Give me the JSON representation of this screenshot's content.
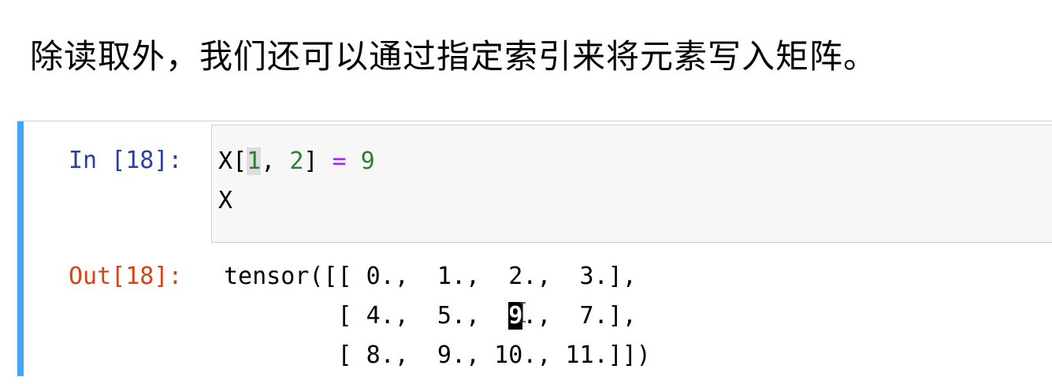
{
  "markdown": {
    "text": "除读取外，我们还可以通过指定索引来将元素写入矩阵。"
  },
  "cell": {
    "in_prompt": "In [18]:",
    "out_prompt": "Out[18]:",
    "code": {
      "var": "X",
      "open_bracket": "[",
      "index_row": "1",
      "comma": ", ",
      "index_col": "2",
      "close_bracket": "]",
      "assign": " = ",
      "value": "9",
      "line2": "X"
    },
    "output": {
      "line1": "tensor([[ 0.,  1.,  2.,  3.],",
      "line2_pre": "        [ 4.,  5.,  ",
      "line2_sel": "9",
      "line2_post": ".,  7.],",
      "line3": "        [ 8.,  9., 10., 11.]])"
    },
    "colors": {
      "in_prompt": "#303f9f",
      "out_prompt": "#d84315",
      "cell_bar": "#42a5f5",
      "number": "#2e7d32",
      "operator": "#aa22ff"
    }
  }
}
